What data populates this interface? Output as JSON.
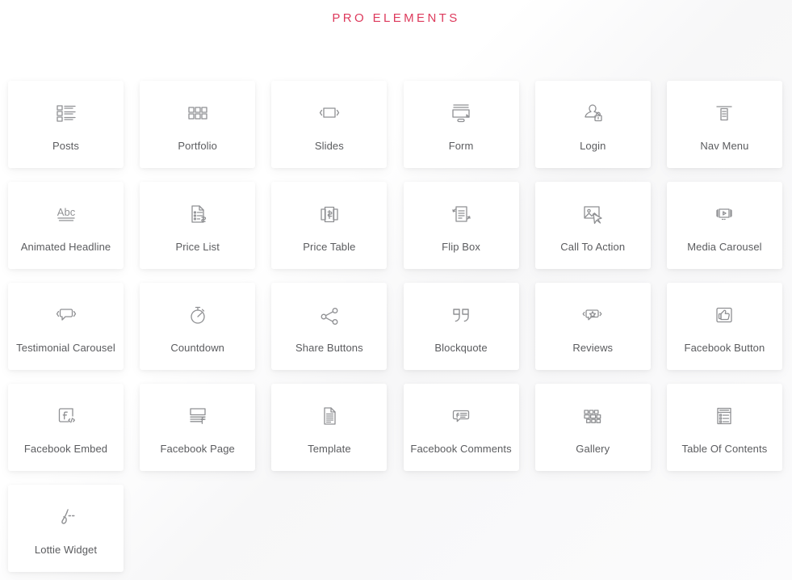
{
  "page": {
    "title": "PRO ELEMENTS",
    "title_color": "#dd3a5c",
    "background_color": "#ffffff",
    "card_background": "#ffffff",
    "icon_color": "#8f9093",
    "label_color": "#5b5c5f",
    "columns": 6
  },
  "elements": [
    {
      "label": "Posts",
      "icon": "posts-list-icon"
    },
    {
      "label": "Portfolio",
      "icon": "portfolio-grid-icon"
    },
    {
      "label": "Slides",
      "icon": "slides-carousel-icon"
    },
    {
      "label": "Form",
      "icon": "form-screen-icon"
    },
    {
      "label": "Login",
      "icon": "login-user-lock-icon"
    },
    {
      "label": "Nav Menu",
      "icon": "nav-menu-icon"
    },
    {
      "label": "Animated Headline",
      "icon": "animated-headline-abc-icon"
    },
    {
      "label": "Price List",
      "icon": "price-list-document-icon"
    },
    {
      "label": "Price Table",
      "icon": "price-table-cards-icon"
    },
    {
      "label": "Flip Box",
      "icon": "flip-box-icon"
    },
    {
      "label": "Call To Action",
      "icon": "call-to-action-image-cursor-icon"
    },
    {
      "label": "Media Carousel",
      "icon": "media-carousel-play-icon"
    },
    {
      "label": "Testimonial Carousel",
      "icon": "testimonial-carousel-speech-icon"
    },
    {
      "label": "Countdown",
      "icon": "countdown-stopwatch-icon"
    },
    {
      "label": "Share Buttons",
      "icon": "share-nodes-icon"
    },
    {
      "label": "Blockquote",
      "icon": "blockquote-quotes-icon"
    },
    {
      "label": "Reviews",
      "icon": "reviews-star-speech-icon"
    },
    {
      "label": "Facebook Button",
      "icon": "facebook-thumbs-up-icon"
    },
    {
      "label": "Facebook Embed",
      "icon": "facebook-embed-code-icon"
    },
    {
      "label": "Facebook Page",
      "icon": "facebook-page-icon"
    },
    {
      "label": "Template",
      "icon": "template-document-icon"
    },
    {
      "label": "Facebook Comments",
      "icon": "facebook-comments-icon"
    },
    {
      "label": "Gallery",
      "icon": "gallery-grid-icon"
    },
    {
      "label": "Table Of Contents",
      "icon": "table-of-contents-icon"
    },
    {
      "label": "Lottie Widget",
      "icon": "lottie-animation-icon"
    }
  ]
}
